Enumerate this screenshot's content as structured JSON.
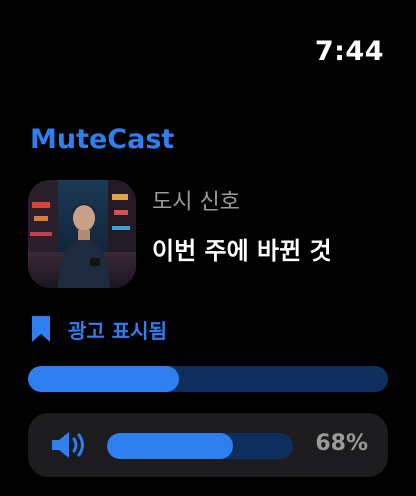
{
  "status": {
    "time": "7:44"
  },
  "app": {
    "name": "MuteCast"
  },
  "now_playing": {
    "show": "도시 신호",
    "episode": "이번 주에 바뀐 것",
    "artwork_icon": "podcast-artwork-image"
  },
  "ad": {
    "label": "광고 표시됨",
    "icon": "bookmark-icon"
  },
  "playback": {
    "progress": 0.42
  },
  "volume": {
    "percent_text": "68%",
    "level": 0.68,
    "icon": "speaker-icon"
  },
  "colors": {
    "accent": "#2F7FF0",
    "track": "#0E2F5E",
    "panel": "#1C1C1E",
    "secondary_text": "#9a9a9a"
  }
}
